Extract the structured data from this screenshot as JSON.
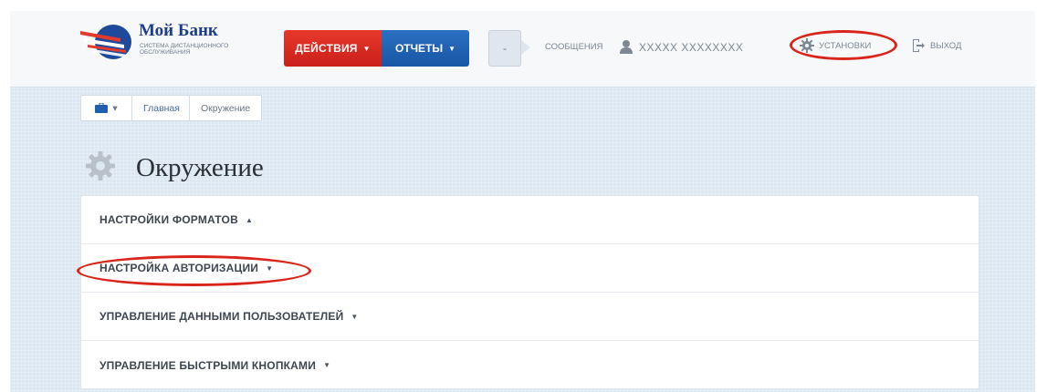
{
  "header": {
    "brand_name": "Мой Банк",
    "brand_sub": "система дистанционного обслуживания",
    "actions_label": "ДЕЙСТВИЯ",
    "reports_label": "ОТЧЕТЫ",
    "messages_count": "-",
    "messages_label": "СООБЩЕНИЯ",
    "user_name": "XXXXX XXXXXXXX",
    "settings_label": "УСТАНОВКИ",
    "logout_label": "ВЫХОД",
    "caret_icon": "caret-down-icon"
  },
  "breadcrumb": {
    "home_caret": "▾",
    "items": [
      "Главная",
      "Окружение"
    ]
  },
  "page": {
    "title": "Окружение"
  },
  "sections": [
    {
      "label": "НАСТРОЙКИ ФОРМАТОВ",
      "arrow": "▲"
    },
    {
      "label": "НАСТРОЙКА АВТОРИЗАЦИИ",
      "arrow": "▼"
    },
    {
      "label": "УПРАВЛЕНИЕ ДАННЫМИ ПОЛЬЗОВАТЕЛЕЙ",
      "arrow": "▼"
    },
    {
      "label": "УПРАВЛЕНИЕ БЫСТРЫМИ КНОПКАМИ",
      "arrow": "▼"
    }
  ],
  "colors": {
    "actions": "#d9261c",
    "reports": "#1f5fb0",
    "highlight": "#d9261c",
    "brand": "#1f3d8a"
  }
}
